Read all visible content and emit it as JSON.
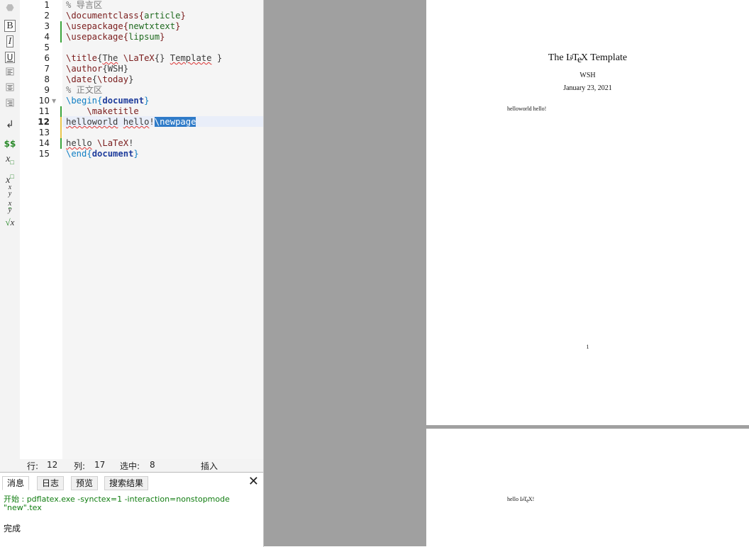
{
  "editor": {
    "lines": [
      {
        "n": "1",
        "text": "% 导言区"
      },
      {
        "n": "2",
        "text": "\\documentclass{article}"
      },
      {
        "n": "3",
        "text": "\\usepackage{newtxtext}"
      },
      {
        "n": "4",
        "text": "\\usepackage{lipsum}"
      },
      {
        "n": "5",
        "text": ""
      },
      {
        "n": "6",
        "text": "\\title{The \\LaTeX{} Template }"
      },
      {
        "n": "7",
        "text": "\\author{WSH}"
      },
      {
        "n": "8",
        "text": "\\date{\\today}"
      },
      {
        "n": "9",
        "text": "% 正文区"
      },
      {
        "n": "10",
        "text": "\\begin{document}"
      },
      {
        "n": "11",
        "text": "    \\maketitle"
      },
      {
        "n": "12",
        "text": "helloworld hello!\\newpage"
      },
      {
        "n": "13",
        "text": ""
      },
      {
        "n": "14",
        "text": "hello \\LaTeX!"
      },
      {
        "n": "15",
        "text": "\\end{document}"
      }
    ],
    "current_line": 12
  },
  "toolbar": {
    "icons": [
      "undo-icon",
      "bold-icon",
      "italic-icon",
      "underline-icon",
      "align-left-icon",
      "align-center-icon",
      "align-right-icon",
      "newline-icon",
      "display-math-icon",
      "subscript-icon",
      "superscript-icon",
      "fraction-icon",
      "dfrac-icon",
      "sqrt-icon"
    ],
    "bold": "B",
    "italic": "I",
    "underline": "U",
    "math": "$$"
  },
  "status": {
    "row_label": "行:",
    "row": "12",
    "col_label": "列:",
    "col": "17",
    "sel_label": "选中:",
    "sel": "8",
    "mode": "插入"
  },
  "messages": {
    "tabs": [
      "消息",
      "日志",
      "预览",
      "搜索结果"
    ],
    "active_tab": 0,
    "line1": "开始 : pdflatex.exe -synctex=1 -interaction=nonstopmode",
    "line2": "\"new\".tex",
    "done": "完成"
  },
  "preview": {
    "page1": {
      "title_pre": "The ",
      "title_post": " Template",
      "author": "WSH",
      "date": "January 23, 2021",
      "body": "helloworld hello!",
      "page_number": "1"
    },
    "page2": {
      "body_pre": "hello "
    },
    "latex_logo": "LaTeX",
    "latex_logo_suffix": "!"
  }
}
